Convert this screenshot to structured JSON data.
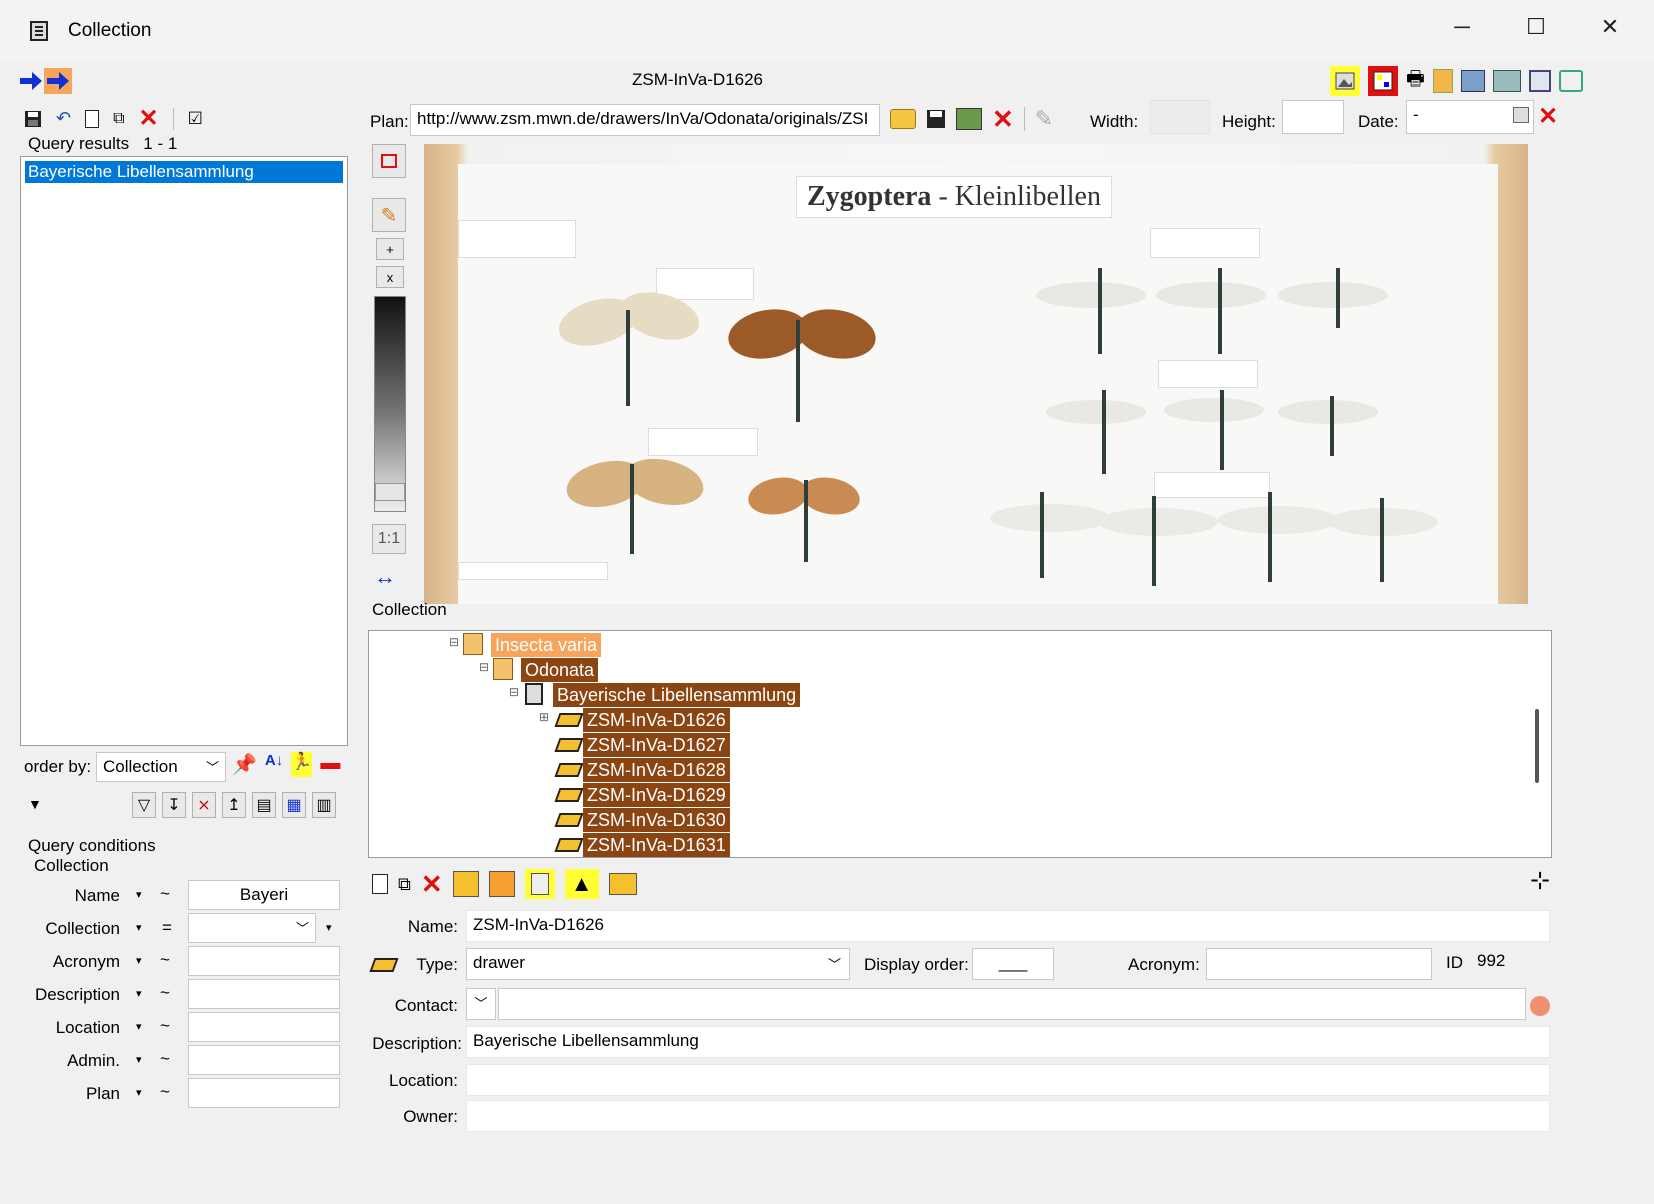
{
  "window": {
    "title": "Collection",
    "minimize": "─",
    "maximize": "☐",
    "close": "✕"
  },
  "header": {
    "record_title": "ZSM-InVa-D1626"
  },
  "left": {
    "query_results_label": "Query results",
    "query_results_count": "1 - 1",
    "results": [
      "Bayerische Libellensammlung"
    ],
    "order_by_label": "order by:",
    "order_by_value": "Collection",
    "query_conditions_label": "Query conditions",
    "collection_group_label": "Collection",
    "conditions": [
      {
        "label": "Name",
        "op": "~",
        "value": "Bayeri"
      },
      {
        "label": "Collection",
        "op": "=",
        "value": ""
      },
      {
        "label": "Acronym",
        "op": "~",
        "value": ""
      },
      {
        "label": "Description",
        "op": "~",
        "value": ""
      },
      {
        "label": "Location",
        "op": "~",
        "value": ""
      },
      {
        "label": "Admin.",
        "op": "~",
        "value": ""
      },
      {
        "label": "Plan",
        "op": "~",
        "value": ""
      }
    ]
  },
  "plan": {
    "label": "Plan:",
    "url": "http://www.zsm.mwn.de/drawers/InVa/Odonata/originals/ZSI",
    "width_label": "Width:",
    "width_value": "",
    "height_label": "Height:",
    "height_value": "",
    "date_label": "Date:",
    "date_value": "-"
  },
  "image": {
    "heading": "Zygoptera",
    "heading_sep": "-",
    "heading_sub": "Kleinlibellen",
    "zoom_label": "1:1"
  },
  "tree": {
    "section_label": "Collection",
    "nodes": [
      {
        "label": "Insecta varia",
        "color": "#f7a45c"
      },
      {
        "label": "Odonata",
        "color": "#8b4513"
      },
      {
        "label": "Bayerische Libellensammlung",
        "color": "#8b4513"
      },
      {
        "label": "ZSM-InVa-D1626",
        "color": "#8b4513"
      },
      {
        "label": "ZSM-InVa-D1627",
        "color": "#8b4513"
      },
      {
        "label": "ZSM-InVa-D1628",
        "color": "#8b4513"
      },
      {
        "label": "ZSM-InVa-D1629",
        "color": "#8b4513"
      },
      {
        "label": "ZSM-InVa-D1630",
        "color": "#8b4513"
      },
      {
        "label": "ZSM-InVa-D1631",
        "color": "#8b4513"
      }
    ]
  },
  "detail": {
    "name_label": "Name:",
    "name_value": "ZSM-InVa-D1626",
    "type_label": "Type:",
    "type_value": "drawer",
    "display_order_label": "Display order:",
    "display_order_value": "___",
    "acronym_label": "Acronym:",
    "acronym_value": "",
    "id_label": "ID",
    "id_value": "992",
    "contact_label": "Contact:",
    "contact_value": "",
    "description_label": "Description:",
    "description_value": "Bayerische Libellensammlung",
    "location_label": "Location:",
    "location_value": "",
    "owner_label": "Owner:",
    "owner_value": ""
  }
}
